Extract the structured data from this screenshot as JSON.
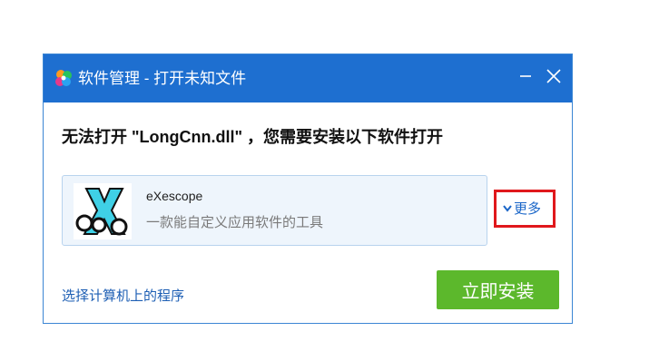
{
  "window": {
    "title": "软件管理 - 打开未知文件",
    "title_bar_color": "#1e6fd0",
    "controls": [
      "minimize-icon",
      "close-icon"
    ]
  },
  "main": {
    "heading": "无法打开 \"LongCnn.dll\" ，您需要安装以下软件打开"
  },
  "software": {
    "name": "eXescope",
    "description": "一款能自定义应用软件的工具",
    "icon": "exescope-logo-icon"
  },
  "more": {
    "label": "更多",
    "icon": "chevron-down-icon",
    "highlight_color": "#e0181c"
  },
  "footer": {
    "choose_program_link": "选择计算机上的程序",
    "install_button": "立即安装",
    "install_button_color": "#5cb82c"
  }
}
